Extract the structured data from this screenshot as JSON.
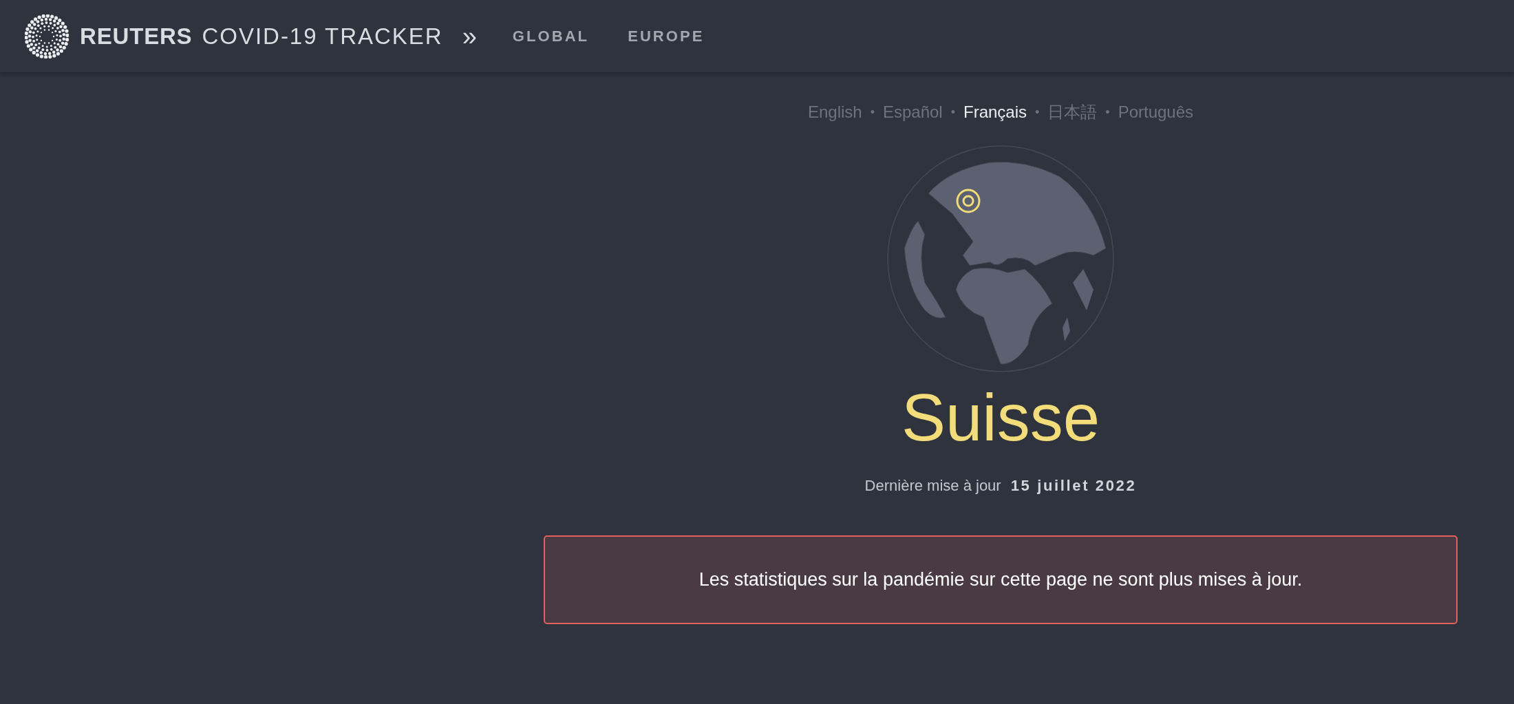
{
  "header": {
    "brand": "REUTERS",
    "product": "COVID-19 TRACKER",
    "separator": "»",
    "nav": [
      {
        "label": "GLOBAL"
      },
      {
        "label": "EUROPE"
      }
    ]
  },
  "languages": [
    {
      "label": "English",
      "selected": false
    },
    {
      "label": "Español",
      "selected": false
    },
    {
      "label": "Français",
      "selected": true
    },
    {
      "label": "日本語",
      "selected": false
    },
    {
      "label": "Português",
      "selected": false
    }
  ],
  "separator_dot": "•",
  "country": "Suisse",
  "updated": {
    "label": "Dernière mise à jour",
    "date": "15 juillet 2022"
  },
  "notice": "Les statistiques sur la pandémie sur cette page ne sont plus mises à jour."
}
